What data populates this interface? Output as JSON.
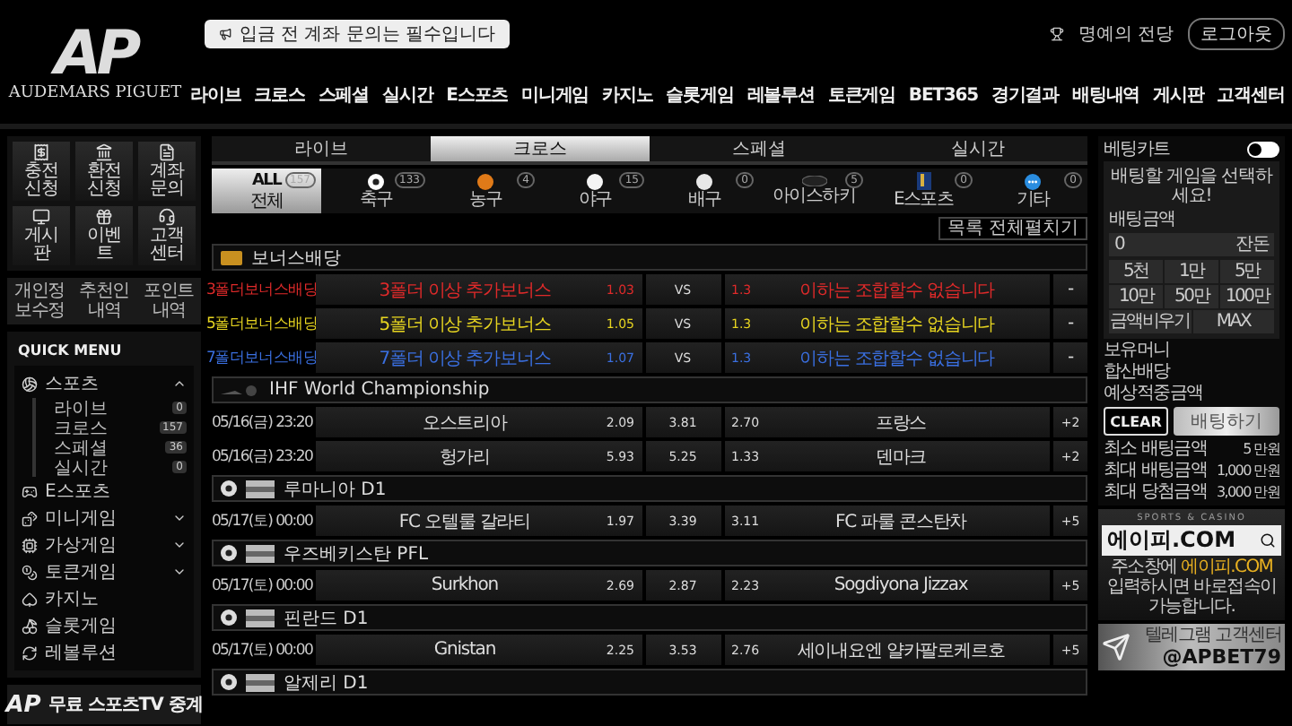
{
  "header": {
    "logo": {
      "mark": "AP",
      "name": "AUDEMARS PIGUET"
    },
    "notice": "입금 전 계좌 문의는 필수입니다",
    "hall_of_fame": "명예의 전당",
    "logout": "로그아웃",
    "nav": [
      "라이브",
      "크로스",
      "스페셜",
      "실시간",
      "E스포츠",
      "미니게임",
      "카지노",
      "슬롯게임",
      "레볼루션",
      "토큰게임",
      "BET365",
      "경기결과",
      "배팅내역",
      "게시판",
      "고객센터"
    ]
  },
  "sidebar": {
    "tiles": [
      {
        "label": "충전신청",
        "kind": "deposit"
      },
      {
        "label": "환전신청",
        "kind": "bank"
      },
      {
        "label": "계좌문의",
        "kind": "document"
      },
      {
        "label": "게시판",
        "kind": "board"
      },
      {
        "label": "이벤트",
        "kind": "event"
      },
      {
        "label": "고객센터",
        "kind": "support"
      }
    ],
    "links": [
      "개인정보수정",
      "추천인내역",
      "포인트내역"
    ],
    "quick_menu": {
      "title": "QUICK MENU",
      "items": [
        {
          "label": "스포츠",
          "kind": "sports",
          "expanded": true,
          "children": [
            {
              "label": "라이브",
              "count": "0"
            },
            {
              "label": "크로스",
              "count": "157"
            },
            {
              "label": "스페셜",
              "count": "36"
            },
            {
              "label": "실시간",
              "count": "0"
            }
          ]
        },
        {
          "label": "E스포츠",
          "kind": "esports"
        },
        {
          "label": "미니게임",
          "kind": "mini",
          "expanded": false
        },
        {
          "label": "가상게임",
          "kind": "virtual",
          "expanded": false
        },
        {
          "label": "토큰게임",
          "kind": "token",
          "expanded": false
        },
        {
          "label": "카지노",
          "kind": "casino"
        },
        {
          "label": "슬롯게임",
          "kind": "slot"
        },
        {
          "label": "레볼루션",
          "kind": "revolution"
        }
      ]
    },
    "banner": {
      "mark": "AP",
      "text": "무료 스포츠TV 중계"
    }
  },
  "main": {
    "tabs": [
      {
        "label": "라이브",
        "selected": false
      },
      {
        "label": "크로스",
        "selected": true
      },
      {
        "label": "스페셜",
        "selected": false
      },
      {
        "label": "실시간",
        "selected": false
      }
    ],
    "sports": [
      {
        "label": "전체",
        "title": "ALL",
        "count": "157",
        "kind": "all",
        "selected": true
      },
      {
        "label": "축구",
        "count": "133",
        "kind": "soccer",
        "selected": false
      },
      {
        "label": "농구",
        "count": "4",
        "kind": "basketball",
        "selected": false
      },
      {
        "label": "야구",
        "count": "15",
        "kind": "baseball",
        "selected": false
      },
      {
        "label": "배구",
        "count": "0",
        "kind": "volleyball",
        "selected": false
      },
      {
        "label": "아이스하키",
        "count": "5",
        "kind": "hockey",
        "selected": false
      },
      {
        "label": "E스포츠",
        "count": "0",
        "kind": "esports",
        "selected": false
      },
      {
        "label": "기타",
        "count": "0",
        "kind": "other",
        "selected": false
      }
    ],
    "expand_all": "목록 전체펼치기",
    "bonus": {
      "title": "보너스배당",
      "rows": [
        {
          "name": "3폴더보너스배당",
          "desc": "3폴더 이상 추가보너스",
          "odds": "1.03",
          "vs": "VS",
          "min": "1.3",
          "note": "이하는 조합할수 없습니다",
          "more": "-",
          "color": "#e02a2a"
        },
        {
          "name": "5폴더보너스배당",
          "desc": "5폴더 이상 추가보너스",
          "odds": "1.05",
          "vs": "VS",
          "min": "1.3",
          "note": "이하는 조합할수 없습니다",
          "more": "-",
          "color": "#e6d420"
        },
        {
          "name": "7폴더보너스배당",
          "desc": "7폴더 이상 추가보너스",
          "odds": "1.07",
          "vs": "VS",
          "min": "1.3",
          "note": "이하는 조합할수 없습니다",
          "more": "-",
          "color": "#3a6fe0"
        }
      ]
    },
    "leagues": [
      {
        "name": "IHF World Championship",
        "kind": "handball",
        "matches": [
          {
            "time": "05/16(금) 23:20",
            "home": "오스트리아",
            "home_odds": "2.09",
            "draw": "3.81",
            "away_odds": "2.70",
            "away": "프랑스",
            "more": "+2"
          },
          {
            "time": "05/16(금) 23:20",
            "home": "헝가리",
            "home_odds": "5.93",
            "draw": "5.25",
            "away_odds": "1.33",
            "away": "덴마크",
            "more": "+2"
          }
        ]
      },
      {
        "name": "루마니아 D1",
        "kind": "soccer",
        "flag": true,
        "matches": [
          {
            "time": "05/17(토) 00:00",
            "home": "FC 오텔룰 갈라티",
            "home_odds": "1.97",
            "draw": "3.39",
            "away_odds": "3.11",
            "away": "FC 파룰 콘스탄차",
            "more": "+5"
          }
        ]
      },
      {
        "name": "우즈베키스탄 PFL",
        "kind": "soccer",
        "flag": true,
        "matches": [
          {
            "time": "05/17(토) 00:00",
            "home": "Surkhon",
            "home_odds": "2.69",
            "draw": "2.87",
            "away_odds": "2.23",
            "away": "Sogdiyona Jizzax",
            "more": "+5"
          }
        ]
      },
      {
        "name": "핀란드 D1",
        "kind": "soccer",
        "flag": true,
        "matches": [
          {
            "time": "05/17(토) 00:00",
            "home": "Gnistan",
            "home_odds": "2.25",
            "draw": "3.53",
            "away_odds": "2.76",
            "away": "세이내요엔 얄카팔로케르호",
            "more": "+5"
          }
        ]
      },
      {
        "name": "알제리 D1",
        "kind": "soccer",
        "flag": true
      }
    ]
  },
  "cart": {
    "title": "베팅카트",
    "on": false,
    "message": "배팅할 게임을 선택하세요!",
    "amount_label": "배팅금액",
    "amount": "0",
    "unit": "잔돈",
    "chips": [
      "5천",
      "1만",
      "5만",
      "10만",
      "50만",
      "100만",
      "금액비우기",
      "MAX"
    ],
    "info": [
      "보유머니",
      "합산배당",
      "예상적중금액"
    ],
    "clear": "CLEAR",
    "bet": "배팅하기",
    "limits": [
      {
        "label": "최소 배팅금액",
        "value": "5 만원"
      },
      {
        "label": "최대 배팅금액",
        "value": "1,000 만원"
      },
      {
        "label": "최대 당첨금액",
        "value": "3,000 만원"
      }
    ]
  },
  "promo": {
    "tagline": "SPORTS & CASINO",
    "domain": "에이피.COM",
    "text": "주소창에 **에이피.COM** 입력하시면 바로접속이 가능합니다."
  },
  "telegram": {
    "title": "텔레그램 고객센터",
    "handle": "@APBET79"
  }
}
